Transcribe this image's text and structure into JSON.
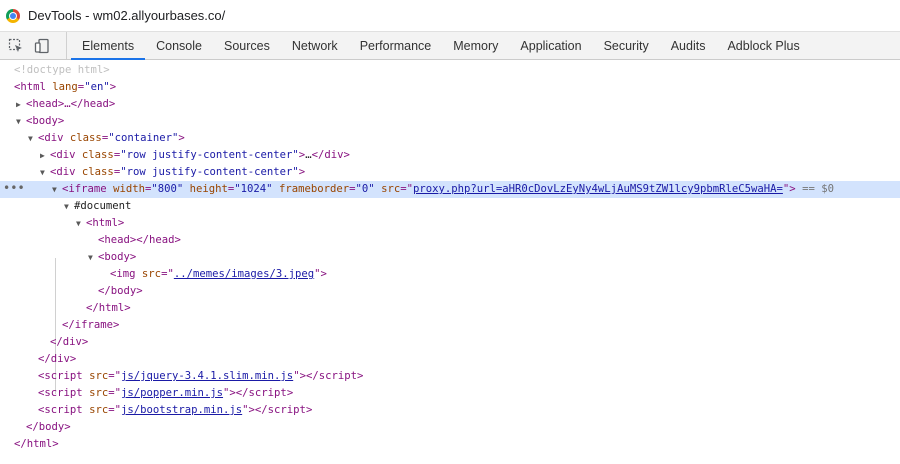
{
  "window": {
    "title": "DevTools - wm02.allyourbases.co/"
  },
  "toolbar": {
    "icons": [
      "inspect-element-icon",
      "device-toolbar-icon"
    ],
    "tabs": [
      "Elements",
      "Console",
      "Sources",
      "Network",
      "Performance",
      "Memory",
      "Application",
      "Security",
      "Audits",
      "Adblock Plus"
    ],
    "active_tab": "Elements"
  },
  "dom": {
    "doctype": "<!doctype html>",
    "html_open": "<html",
    "html_lang_attr": "lang",
    "html_lang_val": "\"en\"",
    "head_collapsed": "<head>…</head>",
    "body_open": "<body>",
    "div": "div",
    "class": "class",
    "container": "\"container\"",
    "row_jc": "\"row justify-content-center\"",
    "ellipsis": "…",
    "iframe": "iframe",
    "width_attr": "width",
    "width_val": "\"800\"",
    "height_attr": "height",
    "height_val": "\"1024\"",
    "frameborder_attr": "frameborder",
    "frameborder_val": "\"0\"",
    "src_attr": "src",
    "iframe_src": "proxy.php?url=aHR0cDovLzEyNy4wLjAuMS9tZW1lcy9pbmRleC5waHA=",
    "selected_marker": "== $0",
    "document": "#document",
    "html": "html",
    "head_empty": "<head></head>",
    "body": "body",
    "img": "img",
    "img_src": "../memes/images/3.jpeg",
    "script": "script",
    "script1": "js/jquery-3.4.1.slim.min.js",
    "script2": "js/popper.min.js",
    "script3": "js/bootstrap.min.js"
  }
}
